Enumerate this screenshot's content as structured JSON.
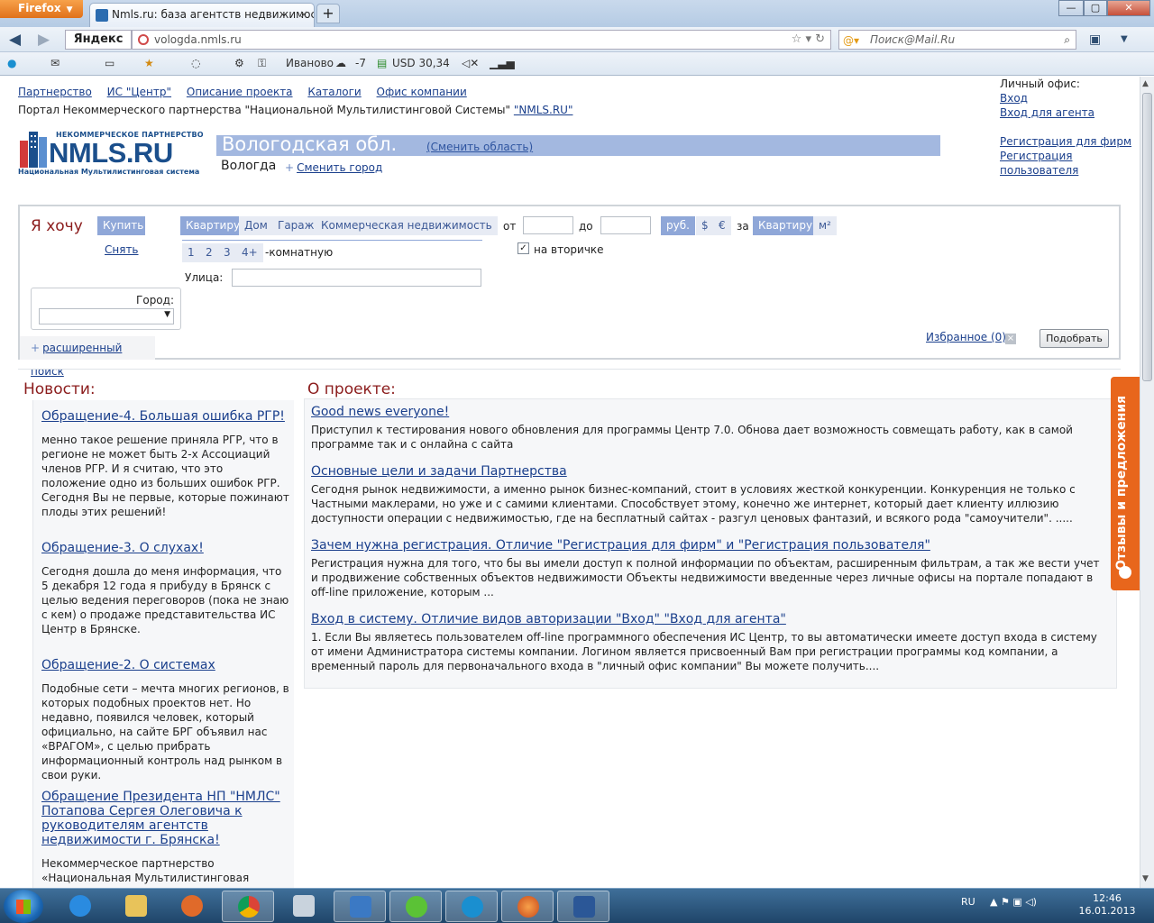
{
  "browser": {
    "app_button": "Firefox",
    "tab_title": "Nmls.ru: база агентств недвижимости. ...",
    "new_tab": "+",
    "url": "vologda.nmls.ru",
    "yandex": "Яндекс",
    "search_placeholder": "Поиск@Mail.Ru",
    "toolbar": {
      "city": "Иваново",
      "weather": "-7",
      "currency": "USD 30,34"
    }
  },
  "header": {
    "nav": [
      "Партнерство",
      "ИС \"Центр\"",
      "Описание проекта",
      "Каталоги",
      "Офис компании"
    ],
    "portal_text": "Портал Некоммерческого партнерства \"Национальной Мультилистинговой Системы\"",
    "portal_link": "\"NMLS.RU\"",
    "office_label": "Личный офис:",
    "login": "Вход",
    "agent_login": "Вход для агента",
    "reg_firms": "Регистрация для фирм",
    "reg_user": "Регистрация пользователя"
  },
  "logo": {
    "top": "НЕКОММЕРЧЕСКОЕ ПАРТНЕРСТВО",
    "main": "NMLS.RU",
    "sub": "Национальная Мультилистинговая система"
  },
  "region": {
    "name": "Вологодская обл.",
    "change": "(Сменить область)",
    "city": "Вологда",
    "change_city": "Сменить город"
  },
  "search": {
    "want": "Я хочу",
    "buy": "Купить",
    "rent": "Снять",
    "types": [
      "Квартиру",
      "Дом",
      "Гараж",
      "Коммерческая недвижимость"
    ],
    "rooms": [
      "1",
      "2",
      "3",
      "4+"
    ],
    "rooms_suffix": "-комнатную",
    "street_label": "Улица:",
    "from": "от",
    "to": "до",
    "currencies": [
      "руб.",
      "$",
      "€"
    ],
    "per": "за",
    "per_units": [
      "Квартиру",
      "м²"
    ],
    "secondary": "на вторичке",
    "city_label": "Город:",
    "advanced": "расширенный поиск",
    "favorites": "Избранное (0)",
    "submit": "Подобрать"
  },
  "news": {
    "title": "Новости:",
    "items": [
      {
        "heading": "Обращение-4. Большая ошибка РГР!",
        "text": "менно такое решение приняла РГР, что в регионе не может быть 2-х Ассоциаций членов РГР. И я считаю, что это положение одно из больших ошибок РГР. Сегодня Вы не первые, которые пожинают плоды этих решений!"
      },
      {
        "heading": "Обращение-3. О слухах!",
        "text": "Сегодня дошла до меня информация, что 5 декабря 12 года я прибуду в Брянск с целью ведения переговоров (пока не знаю с кем) о продаже представительства ИС Центр в Брянске."
      },
      {
        "heading": "Обращение-2. О системах",
        "text": "Подобные сети – мечта многих регионов, в которых подобных проектов нет. Но недавно, появился человек, который официально, на сайте БРГ объявил нас «ВРАГОМ», с целью прибрать информационный контроль над рынком в свои руки."
      },
      {
        "heading": "Обращение Президента НП \"НМЛС\" Потапова Сергея Олеговича к руководителям агентств недвижимости г. Брянска!",
        "text": "Некоммерческое партнерство «Национальная Мультилистинговая Система» создано с целью"
      }
    ]
  },
  "about": {
    "title": "О проекте:",
    "items": [
      {
        "heading": "Good news everyone!",
        "text": "Приступил к тестирования нового обновления для программы Центр 7.0. Обнова дает возможность совмещать работу, как в самой программе так и с онлайна с сайта"
      },
      {
        "heading": "Основные цели и задачи Партнерства",
        "text": "Сегодня рынок недвижимости, а именно рынок бизнес-компаний, стоит в условиях жесткой конкуренции. Конкуренция не только с Частными маклерами, но уже и с самими клиентами. Способствует этому, конечно же интернет, который дает клиенту иллюзию доступности операции с недвижимостью, где на бесплатный сайтах - разгул ценовых фантазий, и всякого рода \"самоучители\". ....."
      },
      {
        "heading": "Зачем нужна регистрация. Отличие \"Регистрация для фирм\" и \"Регистрация пользователя\"",
        "text": "Регистрация нужна для того, что бы вы имели доступ к полной информации по объектам, расширенным фильтрам, а так же вести учет и продвижение собственных объектов недвижимости Объекты недвижимости введенные через личные офисы на портале попадают в off-line приложение, которым ..."
      },
      {
        "heading": "Вход в систему. Отличие видов авторизации \"Вход\" \"Вход для агента\"",
        "text": "1. Если Вы являетесь пользователем off-line программного обеспечения ИС Центр, то вы автоматически имеете доступ входа в систему от имени Администратора системы компании. Логином является присвоенный Вам при регистрации программы код компании, а временный пароль для первоначального входа в \"личный офис компании\" Вы можете получить...."
      }
    ]
  },
  "feedback": "Отзывы и предложения",
  "taskbar": {
    "lang": "RU",
    "time": "12:46",
    "date": "16.01.2013"
  },
  "colors": {
    "accent": "#a3b8e0",
    "heading": "#8b1c1c",
    "link": "#1a3f8c",
    "feedback": "#e8661c"
  }
}
